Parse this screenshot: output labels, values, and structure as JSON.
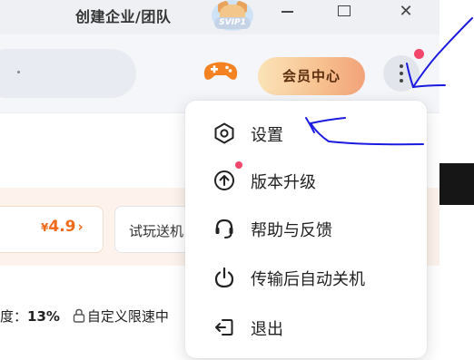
{
  "titlebar": {
    "team_link": "创建企业/团队",
    "svip_badge": "SVIP1",
    "minimize_label": "minimize",
    "maximize_label": "maximize",
    "close_label": "✕"
  },
  "toolbar": {
    "vip_center": "会员中心",
    "game_icon": "gamepad-icon",
    "more_icon": "more-vertical-icon",
    "notification": true
  },
  "promo": {
    "price": "4.9",
    "currency": "¥",
    "price_arrow": "›",
    "trial_text": "试玩送机"
  },
  "status": {
    "speed_label": "度：",
    "speed_value": "13%",
    "custom_limit": "自定义限速中"
  },
  "menu": {
    "items": [
      {
        "label": "设置",
        "icon": "settings-icon"
      },
      {
        "label": "版本升级",
        "icon": "upgrade-icon"
      },
      {
        "label": "帮助与反馈",
        "icon": "headset-icon"
      },
      {
        "label": "传输后自动关机",
        "icon": "power-icon"
      },
      {
        "label": "退出",
        "icon": "exit-icon"
      }
    ]
  },
  "colors": {
    "accent_orange": "#f06a1c",
    "vip_gradient_start": "#fbe3b8",
    "vip_gradient_end": "#f2a27a",
    "notification_red": "#f2466a",
    "annotation_blue": "#1a1ae0"
  }
}
